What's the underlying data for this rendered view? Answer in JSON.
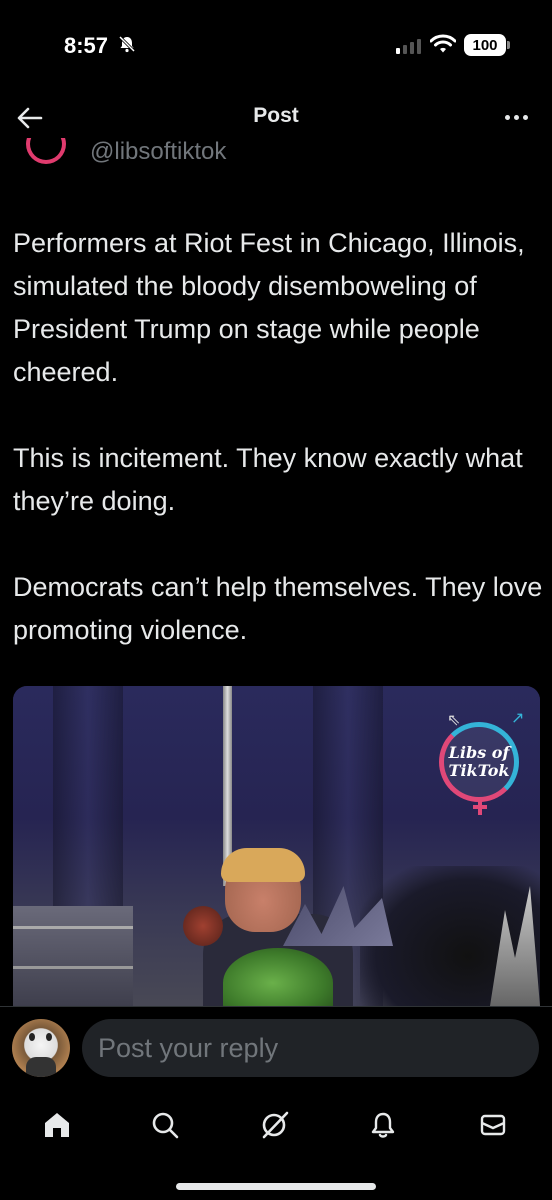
{
  "status_bar": {
    "time": "8:57",
    "battery": "100",
    "icons": [
      "bell-slash-icon",
      "cellular-signal-icon",
      "wifi-icon",
      "battery-icon"
    ]
  },
  "header": {
    "title": "Post",
    "back_icon": "arrow-left-icon",
    "more_icon": "ellipsis-icon"
  },
  "post": {
    "handle": "@libsoftiktok",
    "paragraphs": [
      "Performers at Riot Fest in Chicago, Illinois, simulated the bloody disemboweling of President Trump on stage while people cheered.",
      "This is incitement. They know exactly what they’re doing.",
      "Democrats can’t help themselves. They love promoting violence."
    ],
    "media": {
      "watermark_line1": "Libs of",
      "watermark_line2": "TikTok"
    }
  },
  "reply": {
    "placeholder": "Post your reply"
  },
  "tab_bar": {
    "tabs": [
      "home-icon",
      "search-icon",
      "grok-icon",
      "notifications-icon",
      "messages-icon"
    ]
  },
  "colors": {
    "background": "#000000",
    "text": "#e7e9ea",
    "secondary_text": "#71767b",
    "input_bg": "#202327",
    "brand_pink": "#e04878",
    "brand_blue": "#34b4d8"
  }
}
